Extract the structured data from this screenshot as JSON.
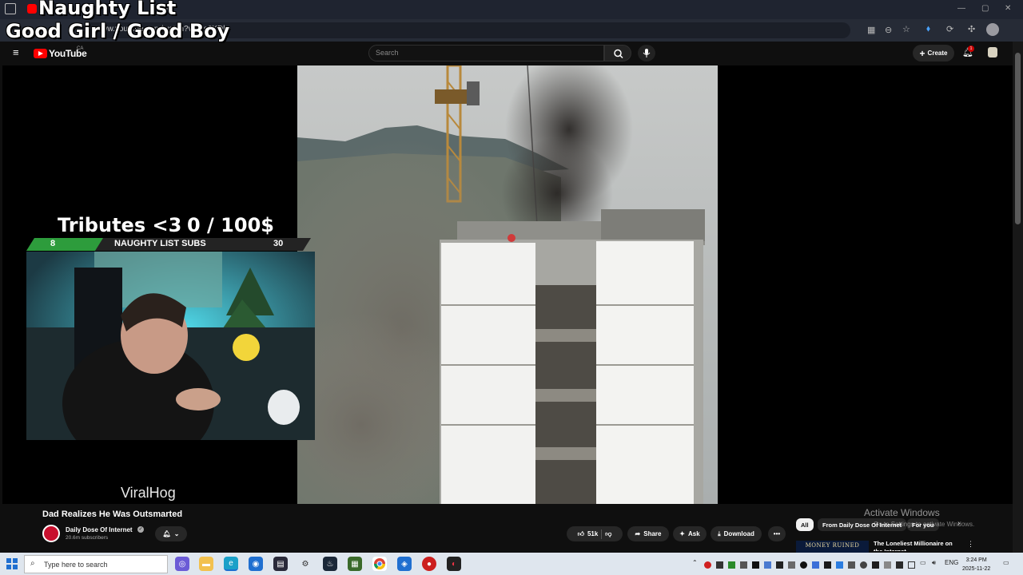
{
  "overlay": {
    "title_line1": "Naughty List",
    "title_line2": "Good Girl / Good Boy",
    "tributes_label": "Tributes <3",
    "tributes_progress": "0 / 100$",
    "subs_bar": {
      "current": "8",
      "label": "NAUGHTY LIST SUBS",
      "goal": "30",
      "fill_fraction": 0.27
    }
  },
  "browser": {
    "url_text": "www.youtube.com/watch?v=...s6KDk",
    "new_tab_icon": "plus-icon"
  },
  "youtube": {
    "logo_text": "YouTube",
    "country_code": "CA",
    "search_placeholder": "Search",
    "create_label": "Create",
    "notification_count": "1"
  },
  "video": {
    "watermark": "ViralHog",
    "title": "Dad Realizes He Was Outsmarted",
    "channel_name": "Daily Dose Of Internet",
    "channel_subs": "20.6m subscribers",
    "like_count": "51k",
    "share_label": "Share",
    "ask_label": "Ask",
    "download_label": "Download"
  },
  "recommendations": {
    "chips": [
      "All",
      "From Daily Dose Of Internet",
      "For you"
    ],
    "activate_windows": "Activate Windows",
    "activate_windows_sub": "Go to Settings to activate Windows.",
    "thumb_text": "MONEY RUINED",
    "first_title": "The Loneliest Millionaire on the Internet"
  },
  "taskbar": {
    "search_placeholder": "Type here to search",
    "language": "ENG",
    "time": "3:24 PM",
    "date": "2025-11-22"
  },
  "colors": {
    "youtube_red": "#ff0000",
    "subs_green": "#2d9c3c",
    "channel_red": "#c8102e"
  }
}
